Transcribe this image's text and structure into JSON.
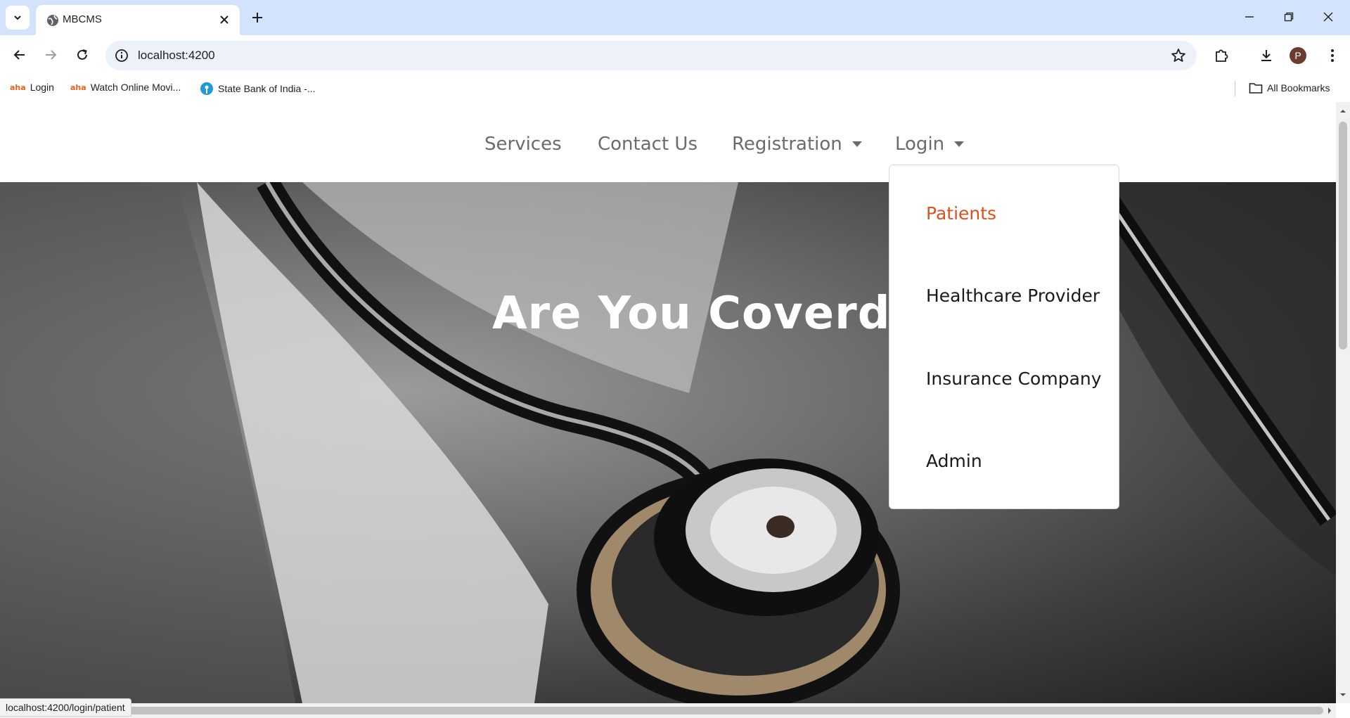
{
  "browser": {
    "tab_title": "MBCMS",
    "url": "localhost:4200",
    "avatar_letter": "P",
    "status_url": "localhost:4200/login/patient"
  },
  "bookmarks": {
    "items": [
      {
        "label": "Login",
        "icon": "aha-icon"
      },
      {
        "label": "Watch Online Movi...",
        "icon": "aha-icon"
      },
      {
        "label": "State Bank of India -...",
        "icon": "sbi-icon"
      }
    ],
    "all_bookmarks": "All Bookmarks"
  },
  "nav": {
    "services": "Services",
    "contact": "Contact Us",
    "registration": "Registration",
    "login": "Login"
  },
  "hero": {
    "title": "Are You Coverd ?"
  },
  "login_menu": {
    "items": [
      "Patients",
      "Healthcare Provider",
      "Insurance Company",
      "Admin"
    ],
    "active_index": 0,
    "active_color": "#d9531e"
  },
  "colors": {
    "tabstrip": "#d3e3fd",
    "omnibox": "#edf2fa",
    "nav_text": "#6b6b6b"
  }
}
